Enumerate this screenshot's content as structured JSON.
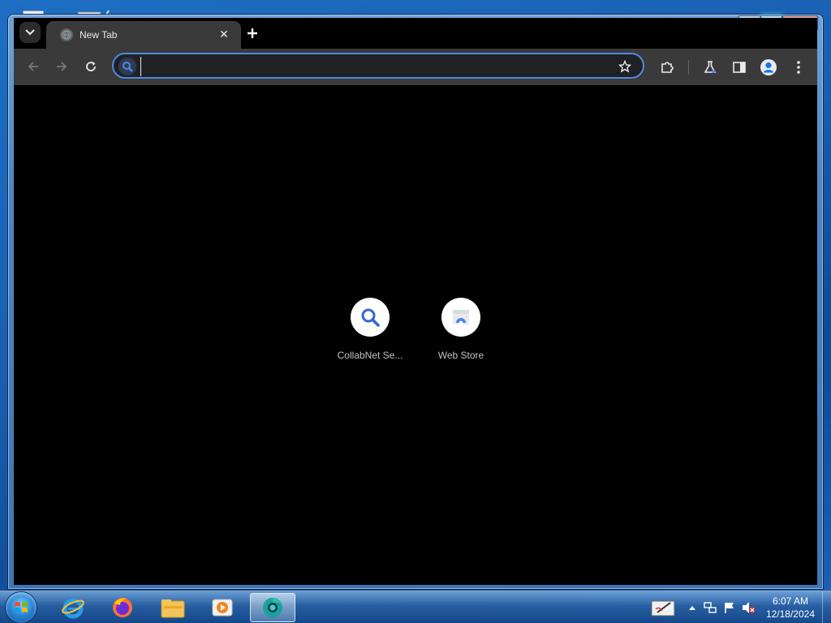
{
  "browser": {
    "tab": {
      "title": "New Tab",
      "close_glyph": "✕"
    },
    "new_tab_glyph": "+",
    "omnibox": {
      "value": "",
      "placeholder": ""
    },
    "shortcuts": [
      {
        "label": "CollabNet Se...",
        "icon": "magnifier-icon"
      },
      {
        "label": "Web Store",
        "icon": "web-store-icon"
      }
    ]
  },
  "window_controls": {
    "minimize": "–",
    "maximize": "□",
    "close": "✕"
  },
  "taskbar": {
    "pinned": [
      "internet-explorer-icon",
      "firefox-icon",
      "file-explorer-icon",
      "media-player-icon",
      "chrome-icon"
    ],
    "tray": {
      "time": "6:07 AM",
      "date": "12/18/2024"
    }
  },
  "colors": {
    "accent": "#4d8ae3",
    "toolbar": "#3a3a3a",
    "content": "#000000"
  }
}
